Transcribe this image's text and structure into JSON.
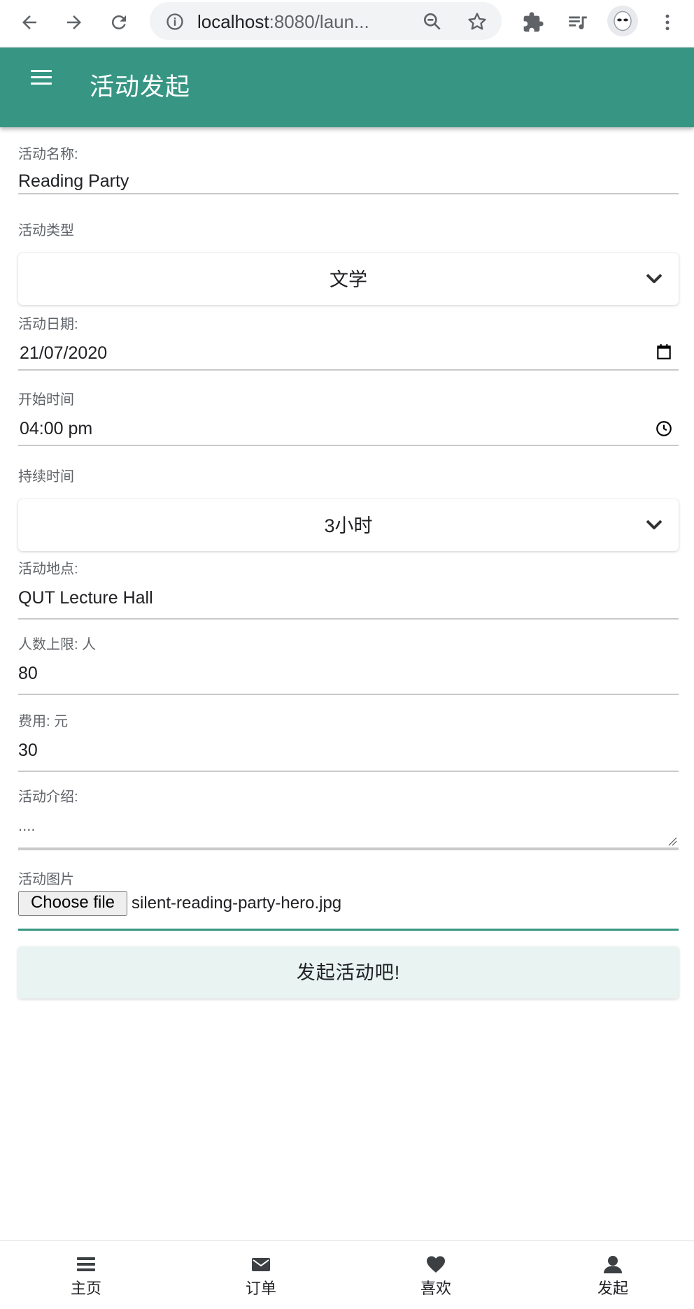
{
  "browser": {
    "url_host": "localhost",
    "url_rest": ":8080/laun...",
    "back_icon": "back-arrow-icon",
    "forward_icon": "forward-arrow-icon",
    "reload_icon": "reload-icon"
  },
  "appbar": {
    "title": "活动发起"
  },
  "form": {
    "name_label": "活动名称:",
    "name_value": "Reading Party",
    "type_label": "活动类型",
    "type_selected": "文学",
    "date_label": "活动日期:",
    "date_value": "21/07/2020",
    "start_label": "开始时间",
    "start_value": "04:00 pm",
    "duration_label": "持续时间",
    "duration_selected": "3小时",
    "location_label": "活动地点:",
    "location_value": "QUT Lecture Hall",
    "capacity_label": "人数上限: 人",
    "capacity_value": "80",
    "fee_label": "费用: 元",
    "fee_value": "30",
    "intro_label": "活动介绍:",
    "intro_value": "....",
    "image_label": "活动图片",
    "choose_file_label": "Choose file",
    "file_name": "silent-reading-party-hero.jpg",
    "submit_label": "发起活动吧!"
  },
  "bottom_nav": {
    "items": [
      {
        "label": "主页",
        "icon": "menu-list-icon"
      },
      {
        "label": "订单",
        "icon": "envelope-icon"
      },
      {
        "label": "喜欢",
        "icon": "heart-icon"
      },
      {
        "label": "发起",
        "icon": "user-icon"
      }
    ]
  },
  "colors": {
    "primary": "#379683",
    "submit_bg": "#e9f4f2"
  }
}
